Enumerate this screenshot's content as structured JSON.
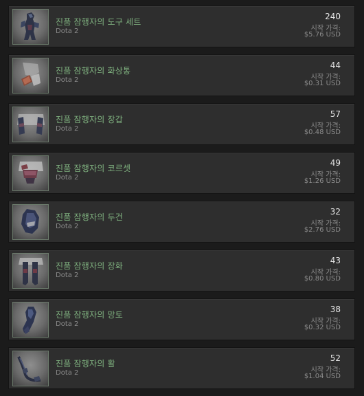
{
  "listings": [
    {
      "name": "진품 잠행자의 도구 세트",
      "game": "Dota 2",
      "quantity": "240",
      "price_label": "시작 가격:",
      "price": "$5.76 USD",
      "icon": "stalker-set-icon"
    },
    {
      "name": "진품 잠행자의 화상통",
      "game": "Dota 2",
      "quantity": "44",
      "price_label": "시작 가격:",
      "price": "$0.31 USD",
      "icon": "burn-case-icon"
    },
    {
      "name": "진품 잠행자의 장갑",
      "game": "Dota 2",
      "quantity": "57",
      "price_label": "시작 가격:",
      "price": "$0.48 USD",
      "icon": "gloves-icon"
    },
    {
      "name": "진품 잠행자의 코르셋",
      "game": "Dota 2",
      "quantity": "49",
      "price_label": "시작 가격:",
      "price": "$1.26 USD",
      "icon": "corset-icon"
    },
    {
      "name": "진품 잠행자의 두건",
      "game": "Dota 2",
      "quantity": "32",
      "price_label": "시작 가격:",
      "price": "$2.76 USD",
      "icon": "hood-icon"
    },
    {
      "name": "진품 잠행자의 장화",
      "game": "Dota 2",
      "quantity": "43",
      "price_label": "시작 가격:",
      "price": "$0.80 USD",
      "icon": "boots-icon"
    },
    {
      "name": "진품 잠행자의 망토",
      "game": "Dota 2",
      "quantity": "38",
      "price_label": "시작 가격:",
      "price": "$0.32 USD",
      "icon": "cape-icon"
    },
    {
      "name": "진품 잠행자의 활",
      "game": "Dota 2",
      "quantity": "52",
      "price_label": "시작 가격:",
      "price": "$1.04 USD",
      "icon": "bow-icon"
    }
  ]
}
